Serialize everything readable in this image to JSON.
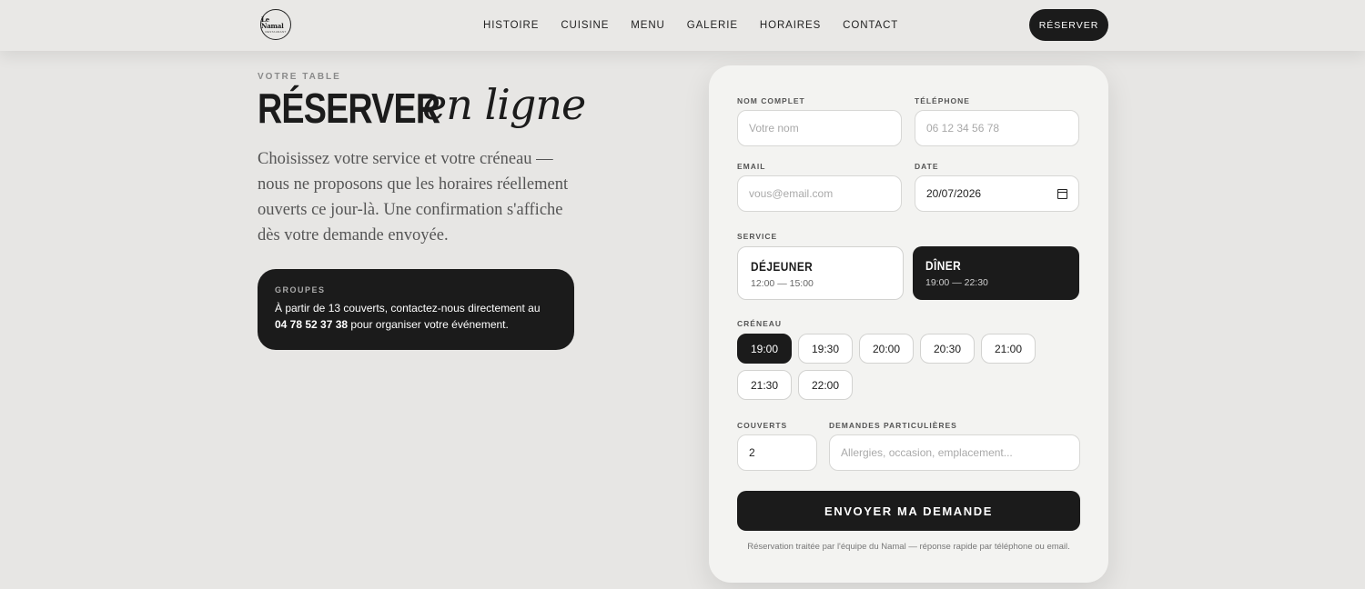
{
  "header": {
    "logo": {
      "name": "Le Namal",
      "tagline": "RESTAURANT"
    },
    "nav": [
      "HISTOIRE",
      "CUISINE",
      "MENU",
      "GALERIE",
      "HORAIRES",
      "CONTACT"
    ],
    "reserve_label": "RÉSERVER"
  },
  "hero": {
    "eyebrow": "VOTRE TABLE",
    "title_main": "RÉSERVER",
    "title_script": "en ligne",
    "intro": "Choisissez votre service et votre créneau — nous ne proposons que les horaires réellement ouverts ce jour-là. Une confirmation s'affiche dès votre demande envoyée."
  },
  "groups": {
    "label": "GROUPES",
    "text_before": "À partir de 13 couverts, contactez-nous directement au",
    "phone": "04 78 52 37 38",
    "text_after": "pour organiser votre événement."
  },
  "form": {
    "name_label": "NOM COMPLET",
    "name_placeholder": "Votre nom",
    "phone_label": "TÉLÉPHONE",
    "phone_placeholder": "06 12 34 56 78",
    "email_label": "EMAIL",
    "email_placeholder": "vous@email.com",
    "date_label": "DATE",
    "date_value": "20/07/2026",
    "service_label": "SERVICE",
    "services": [
      {
        "name": "DÉJEUNER",
        "hours": "12:00 — 15:00",
        "selected": false
      },
      {
        "name": "DÎNER",
        "hours": "19:00 — 22:30",
        "selected": true
      }
    ],
    "slot_label": "CRÉNEAU",
    "slots": [
      "19:00",
      "19:30",
      "20:00",
      "20:30",
      "21:00",
      "21:30",
      "22:00"
    ],
    "selected_slot": "19:00",
    "covers_label": "COUVERTS",
    "covers_value": "2",
    "requests_label": "DEMANDES PARTICULIÈRES",
    "requests_placeholder": "Allergies, occasion, emplacement...",
    "submit_label": "ENVOYER MA DEMANDE",
    "footnote": "Réservation traitée par l'équipe du Namal — réponse rapide par téléphone ou email."
  },
  "colors": {
    "dark": "#1b1b1b",
    "background": "#e7e6e4",
    "card": "#f3f3f1"
  }
}
